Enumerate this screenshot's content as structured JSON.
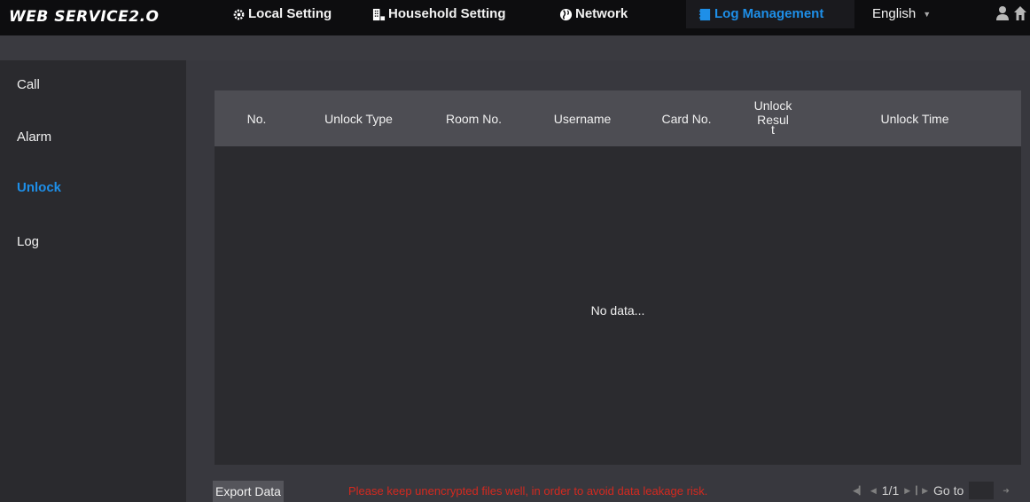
{
  "app": {
    "brand": "WEB SERVICE2.O"
  },
  "nav": {
    "local_setting": "Local Setting",
    "household_setting": "Household Setting",
    "network": "Network",
    "log_management": "Log Management",
    "language": "English"
  },
  "sidebar": {
    "items": [
      {
        "label": "Call"
      },
      {
        "label": "Alarm"
      },
      {
        "label": "Unlock",
        "active": true
      },
      {
        "label": "Log"
      }
    ]
  },
  "table": {
    "columns": [
      "No.",
      "Unlock Type",
      "Room No.",
      "Username",
      "Card No.",
      "Unlock Resul",
      "t",
      "Unlock Time"
    ],
    "empty_text": "No data..."
  },
  "footer": {
    "export_label": "Export Data",
    "warning": "Please keep unencrypted files well, in order to avoid data leakage risk.",
    "page": "1/1",
    "goto_label": "Go to",
    "goto_value": ""
  },
  "colors": {
    "accent": "#1e8fe8",
    "warning": "#d4291f",
    "header": "#0d0d0f"
  }
}
